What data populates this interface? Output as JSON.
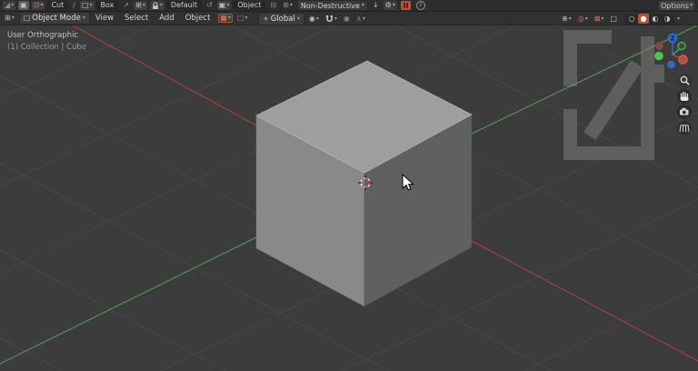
{
  "toolbar": {
    "tool_label": "Cut",
    "shape_label": "Box",
    "operation_label": "Default",
    "mode_label": "Object",
    "behavior_label": "Non-Destructive",
    "options_label": "Options"
  },
  "header": {
    "mode_label": "Object Mode",
    "menus": [
      {
        "label": "View"
      },
      {
        "label": "Select"
      },
      {
        "label": "Add"
      },
      {
        "label": "Object"
      }
    ],
    "orientation_label": "Global"
  },
  "viewport": {
    "view_label": "User Orthographic",
    "collection_label": "(1) Collection | Cube",
    "gizmo_z_label": "Z"
  },
  "icons": {
    "caret": "▾",
    "down_arrow": "↓",
    "logo": "◢",
    "frame": "▣",
    "cut_mode": "⊡",
    "draw": "∕",
    "shape": "□",
    "edit": "↗",
    "array": "⊞",
    "loop": "↺",
    "mode_box": "▣",
    "mirror": "⊟",
    "grid_plus": "⊞",
    "gear": "⚙",
    "editor_type": "⊞",
    "object_mode_icon": "□",
    "tool_red": "▦",
    "tool_gray": "□",
    "orientation": "+",
    "pivot": "◉",
    "prop_edit": "◉",
    "falloff": "∧",
    "gizmo_toggle": "⊕",
    "overlays": "◎",
    "xray_dd": "⊠",
    "xray": "□",
    "wireframe": "○",
    "solid": "●",
    "material": "◐",
    "rendered": "◑",
    "help": "?"
  },
  "colors": {
    "accent": "#c14f33",
    "topbar_bg": "#2d2d2d",
    "header_bg": "#313131",
    "button_bg": "#3f3f3f",
    "button_pressed": "#5a5a5a",
    "text": "#cdcdcd",
    "viewport_bg": "#3c3c3c",
    "grid": "#474747",
    "axis_x": "#a94441",
    "axis_y": "#55a058",
    "cube_top": "#9e9e9e",
    "cube_left": "#87898b",
    "cube_right": "#5e6061",
    "watermark": "#5e5e5e",
    "gizmo_x": "#bd4a41",
    "gizmo_x_dim": "#8c4a45",
    "gizmo_y": "#4cc44a",
    "gizmo_y_outline": "#5bb455",
    "gizmo_z": "#2f6bd3",
    "gizmo_z_dim": "#3a66bf",
    "cursor_red": "#cc4444"
  }
}
